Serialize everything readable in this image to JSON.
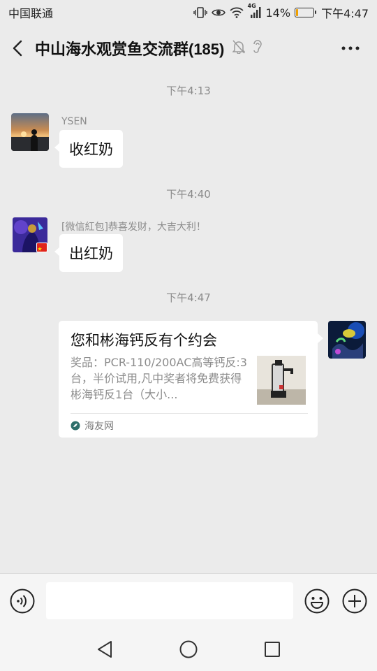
{
  "status_bar": {
    "carrier": "中国联通",
    "network": "4G",
    "battery": "14%",
    "time": "下午4:47"
  },
  "header": {
    "title": "中山海水观赏鱼交流群(185)",
    "back_icon": "chevron-left-icon",
    "mute_icon": "bell-off-icon",
    "earpiece_icon": "ear-icon",
    "more_icon": "more-dots-icon"
  },
  "messages": [
    {
      "type": "time",
      "text": "下午4:13"
    },
    {
      "type": "text",
      "sender": "YSEN",
      "text": "收红奶"
    },
    {
      "type": "time",
      "text": "下午4:40"
    },
    {
      "type": "text",
      "sender": "[微信紅包]恭喜发财，大吉大利！",
      "text": "出红奶"
    },
    {
      "type": "time",
      "text": "下午4:47"
    },
    {
      "type": "link",
      "title": "您和彬海钙反有个约会",
      "description": "奖品：PCR-110/200AC高等钙反:3台，半价试用,凡中奖者将免费获得彬海钙反1台（大小...",
      "source": "海友网"
    }
  ],
  "input_bar": {
    "voice_icon": "voice-icon",
    "message_value": "",
    "emoji_icon": "emoji-icon",
    "plus_icon": "plus-icon"
  },
  "system_nav": {
    "back_icon": "triangle-back-icon",
    "home_icon": "circle-home-icon",
    "recents_icon": "square-recents-icon"
  },
  "colors": {
    "background": "#ebebeb",
    "bubble": "#ffffff",
    "secondary_text": "#8c8c8c",
    "source_icon": "#2d6e6a"
  }
}
